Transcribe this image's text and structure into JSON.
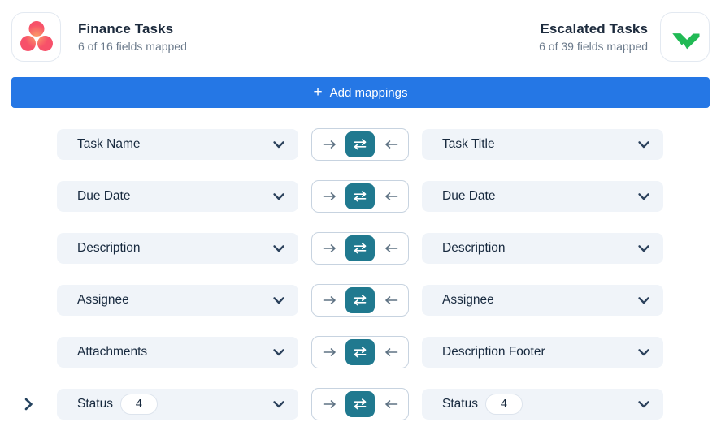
{
  "header": {
    "left": {
      "title": "Finance Tasks",
      "subtitle": "6 of 16 fields mapped",
      "logo": "asana-logo"
    },
    "right": {
      "title": "Escalated Tasks",
      "subtitle": "6 of 39 fields mapped",
      "logo": "wrike-logo"
    }
  },
  "add_button": {
    "plus_icon": "+",
    "label": "Add mappings"
  },
  "rows": [
    {
      "left": {
        "label": "Task Name"
      },
      "right": {
        "label": "Task Title"
      },
      "direction": "two-way",
      "expandable": false
    },
    {
      "left": {
        "label": "Due Date"
      },
      "right": {
        "label": "Due Date"
      },
      "direction": "two-way",
      "expandable": false
    },
    {
      "left": {
        "label": "Description"
      },
      "right": {
        "label": "Description"
      },
      "direction": "two-way",
      "expandable": false
    },
    {
      "left": {
        "label": "Assignee"
      },
      "right": {
        "label": "Assignee"
      },
      "direction": "two-way",
      "expandable": false
    },
    {
      "left": {
        "label": "Attachments"
      },
      "right": {
        "label": "Description Footer"
      },
      "direction": "two-way",
      "expandable": false
    },
    {
      "left": {
        "label": "Status",
        "badge": "4"
      },
      "right": {
        "label": "Status",
        "badge": "4"
      },
      "direction": "two-way",
      "expandable": true
    }
  ],
  "icons": {
    "left_logo": "asana-three-dots",
    "right_logo": "wrike-double-check",
    "sync_selected": "two-way-arrows",
    "sync_right": "arrow-right",
    "sync_left": "arrow-left",
    "select_caret": "chevron-down",
    "row_expand": "chevron-right",
    "button_plus": "plus"
  },
  "colors": {
    "add_button_bg": "#2577e5",
    "sync_active_bg": "#20798f",
    "select_bg": "#f0f4f9",
    "text_primary": "#17293e",
    "text_secondary": "#6b7a8b",
    "wrike_green": "#21ba55",
    "asana_coral": "#f75169",
    "asana_orange": "#fa9e66",
    "border_light": "#c7d3e0"
  }
}
